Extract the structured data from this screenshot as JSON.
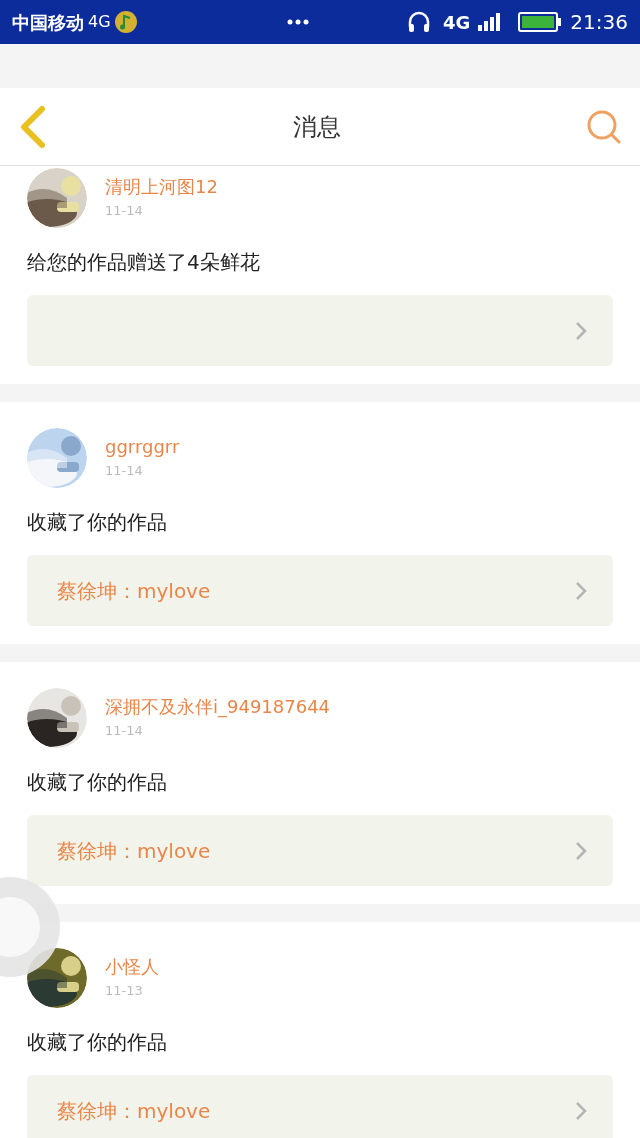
{
  "status_bar": {
    "carrier": "中国移动",
    "network": "4G",
    "signal_network": "4G",
    "time": "21:36"
  },
  "header": {
    "title": "消息"
  },
  "messages": [
    {
      "user": "清明上河图12",
      "date": "11-14",
      "text": "给您的作品赠送了4朵鲜花",
      "cut_top": true
    },
    {
      "user": "ggrrggrr",
      "date": "11-14",
      "text": "收藏了你的作品",
      "work": "蔡徐坤：mylove"
    },
    {
      "user": "深拥不及永伴i_949187644",
      "date": "11-14",
      "text": "收藏了你的作品",
      "work": "蔡徐坤：mylove"
    },
    {
      "user": "小怪人",
      "date": "11-13",
      "text": "收藏了你的作品",
      "work": "蔡徐坤：mylove"
    }
  ]
}
